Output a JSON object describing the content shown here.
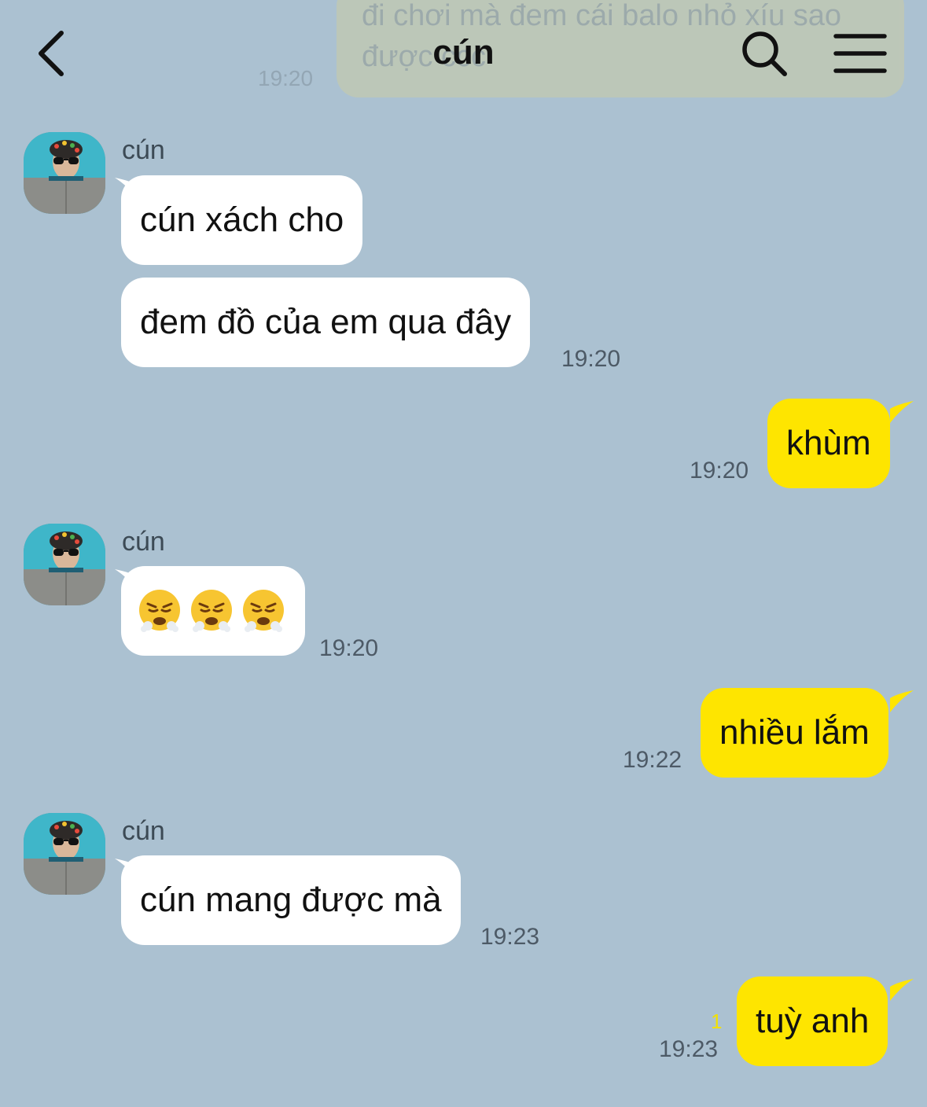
{
  "header": {
    "title": "cún",
    "back_icon": "chevron-left-icon",
    "search_icon": "search-icon",
    "menu_icon": "hamburger-menu-icon"
  },
  "previous_message": {
    "text": "đi chơi mà đem cái balo nhỏ xíu sao được ccc",
    "time": "19:20"
  },
  "colors": {
    "background": "#abc1d1",
    "outgoing_bubble": "#fee500",
    "incoming_bubble": "#ffffff"
  },
  "messages": [
    {
      "from": "cún",
      "type": "incoming",
      "sender_name": "cún",
      "text": "cún xách cho"
    },
    {
      "from": "cún",
      "type": "incoming",
      "text": "đem đồ của em qua đây",
      "time": "19:20"
    },
    {
      "from": "me",
      "type": "outgoing",
      "text": "khùm",
      "time": "19:20"
    },
    {
      "from": "cún",
      "type": "incoming",
      "sender_name": "cún",
      "emoji": [
        "huffing-face-emoji",
        "huffing-face-emoji",
        "huffing-face-emoji"
      ],
      "time": "19:20"
    },
    {
      "from": "me",
      "type": "outgoing",
      "text": "nhiều lắm",
      "time": "19:22"
    },
    {
      "from": "cún",
      "type": "incoming",
      "sender_name": "cún",
      "text": "cún mang được mà",
      "time": "19:23"
    },
    {
      "from": "me",
      "type": "outgoing",
      "text": "tuỳ anh",
      "time": "19:23",
      "unread_count": "1"
    }
  ]
}
